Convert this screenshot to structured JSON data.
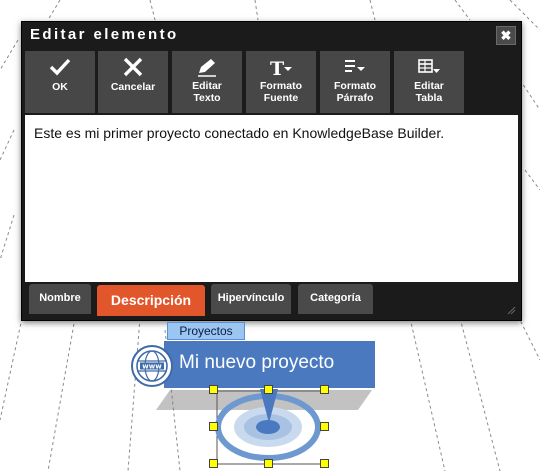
{
  "dialog": {
    "title": "Editar elemento",
    "close_label": "✖"
  },
  "toolbar": [
    {
      "icon": "checkmark-icon",
      "label": "OK"
    },
    {
      "icon": "x-icon",
      "label": "Cancelar"
    },
    {
      "icon": "pencil-icon",
      "label": "Editar\nTexto"
    },
    {
      "icon": "text-format-icon",
      "label": "Formato\nFuente"
    },
    {
      "icon": "paragraph-format-icon",
      "label": "Formato\nPárrafo"
    },
    {
      "icon": "table-edit-icon",
      "label": "Editar\nTabla"
    }
  ],
  "editor": {
    "content": "Este es mi primer proyecto conectado en KnowledgeBase Builder."
  },
  "tabs": [
    {
      "label": "Nombre",
      "active": false
    },
    {
      "label": "Descripción",
      "active": true
    },
    {
      "label": "Hipervínculo",
      "active": false
    },
    {
      "label": "Categoría",
      "active": false
    }
  ],
  "node": {
    "category": "Proyectos",
    "title": "Mi nuevo proyecto",
    "icon": "globe-www-icon",
    "icon_text": "www"
  },
  "colors": {
    "dialog_bg": "#1b1b1b",
    "button_bg": "#474747",
    "active_tab": "#e2562c",
    "node_blue": "#4a79bf",
    "category_label": "#9cc6f2",
    "handle_yellow": "#ffff00"
  }
}
